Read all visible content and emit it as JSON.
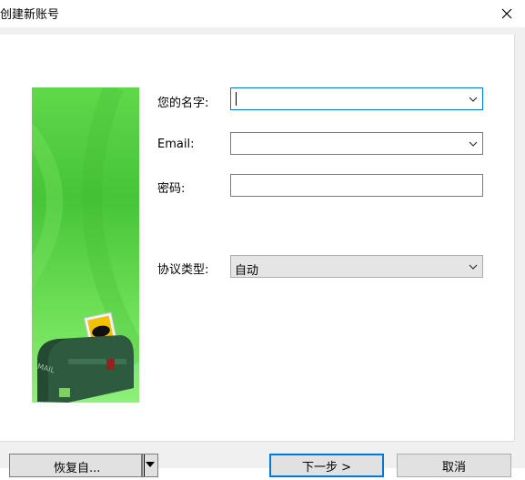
{
  "window": {
    "title": "创建新账号",
    "close_label": "✕"
  },
  "form": {
    "name_label": "您的名字:",
    "name_value": "",
    "email_label": "Email:",
    "email_value": "",
    "password_label": "密码:",
    "password_value": "",
    "protocol_label": "协议类型:",
    "protocol_value": "自动"
  },
  "buttons": {
    "restore_label": "恢复自...",
    "next_label": "下一步 >",
    "cancel_label": "取消"
  },
  "banner": {
    "mailbox_text": "MAIL"
  },
  "colors": {
    "focus": "#0078d7",
    "banner_green": "#47c437"
  }
}
